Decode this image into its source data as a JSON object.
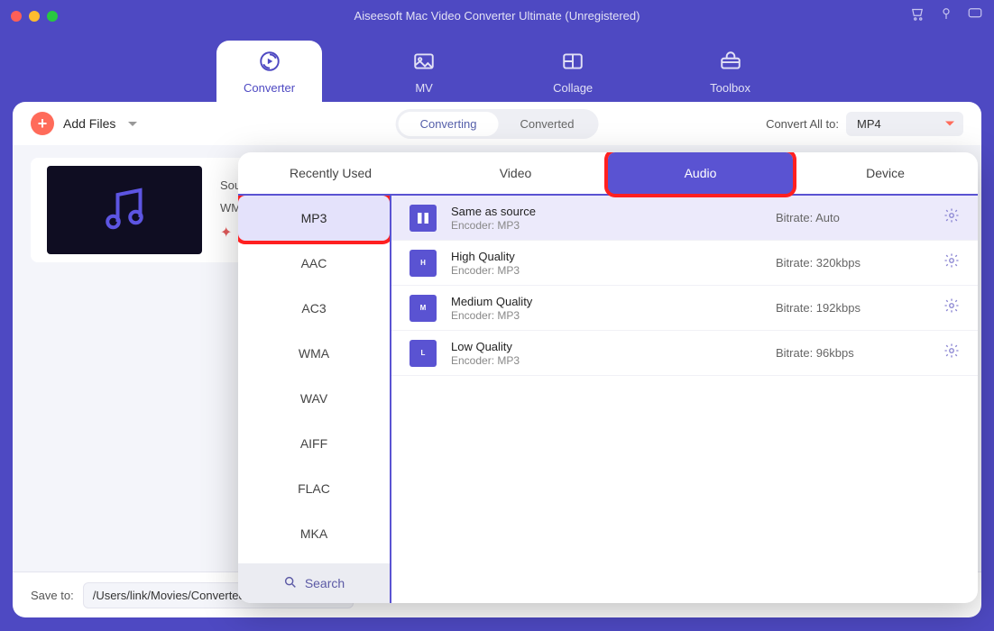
{
  "window": {
    "title": "Aiseesoft Mac Video Converter Ultimate (Unregistered)"
  },
  "nav": {
    "items": [
      {
        "label": "Converter",
        "icon": "converter-icon"
      },
      {
        "label": "MV",
        "icon": "mv-icon"
      },
      {
        "label": "Collage",
        "icon": "collage-icon"
      },
      {
        "label": "Toolbox",
        "icon": "toolbox-icon"
      }
    ],
    "active": 0
  },
  "toolbar": {
    "add_label": "Add Files",
    "segments": [
      "Converting",
      "Converted"
    ],
    "convert_all_label": "Convert All to:",
    "convert_all_value": "MP4"
  },
  "queue": {
    "items": [
      {
        "source_label": "Source:",
        "format": "WMA"
      }
    ]
  },
  "footer": {
    "save_label": "Save to:",
    "path": "/Users/link/Movies/Converted"
  },
  "popover": {
    "tabs": [
      "Recently Used",
      "Video",
      "Audio",
      "Device"
    ],
    "active_tab": 2,
    "formats": [
      "MP3",
      "AAC",
      "AC3",
      "WMA",
      "WAV",
      "AIFF",
      "FLAC",
      "MKA"
    ],
    "active_format": 0,
    "search_label": "Search",
    "presets": [
      {
        "title": "Same as source",
        "encoder": "Encoder: MP3",
        "bitrate": "Bitrate: Auto",
        "badge": "",
        "selected": true
      },
      {
        "title": "High Quality",
        "encoder": "Encoder: MP3",
        "bitrate": "Bitrate: 320kbps",
        "badge": "H",
        "selected": false
      },
      {
        "title": "Medium Quality",
        "encoder": "Encoder: MP3",
        "bitrate": "Bitrate: 192kbps",
        "badge": "M",
        "selected": false
      },
      {
        "title": "Low Quality",
        "encoder": "Encoder: MP3",
        "bitrate": "Bitrate: 96kbps",
        "badge": "L",
        "selected": false
      }
    ]
  }
}
